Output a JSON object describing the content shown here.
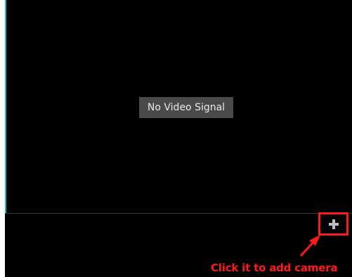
{
  "video_tile": {
    "status_text": "No Video Signal"
  },
  "add_camera": {
    "icon": "plus-icon",
    "annotation_text": "Click it to add camera"
  },
  "colors": {
    "video_background": "#000000",
    "status_box": "#4a4a4a",
    "tile_accent": "#22b8d0",
    "highlight": "#ff1a1a",
    "plus_icon": "#bdbdbd"
  }
}
